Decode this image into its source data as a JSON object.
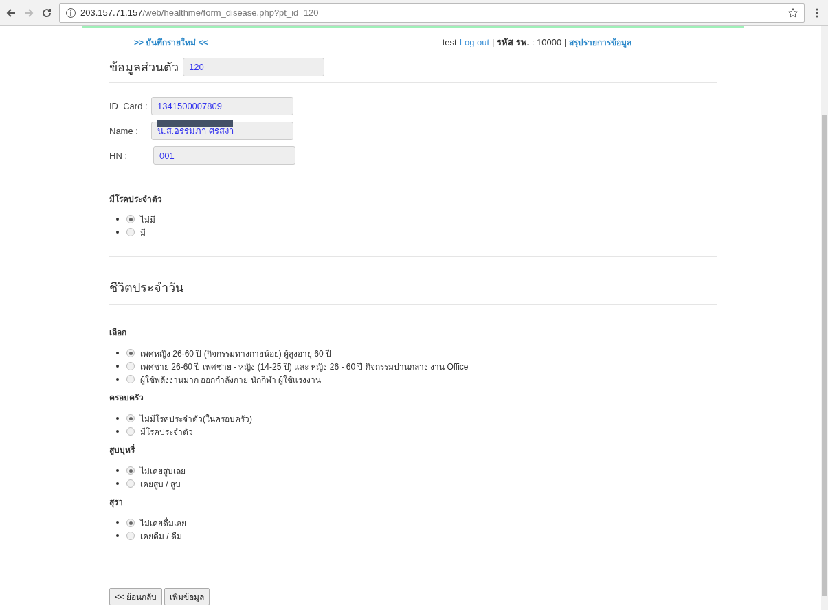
{
  "browser": {
    "url_host": "203.157.71.157",
    "url_path": "/web/healthme/form_disease.php?pt_id=120"
  },
  "header": {
    "new_record_link": ">> บันทึกรายใหม่ <<",
    "user": "test",
    "logout_link": "Log out",
    "hospital_code": "| **รหัส รพ.** : 10000 |",
    "summary_link": "สรุปรายการข้อมูล"
  },
  "personal": {
    "title": "ข้อมูลส่วนตัว",
    "pt_id": "120",
    "fields": [
      {
        "label": "ID_Card :",
        "value": "1341500007809",
        "redacted": false
      },
      {
        "label": "Name :",
        "value": "น.ส.อรรมภา ศรสงา",
        "redacted": true
      },
      {
        "label": "HN :",
        "value": "001",
        "redacted": false
      }
    ]
  },
  "disease": {
    "title": "มีโรคประจำตัว",
    "options": [
      {
        "label": "ไม่มี",
        "selected": true
      },
      {
        "label": "มี",
        "selected": false
      }
    ]
  },
  "daily": {
    "title": "ชีวิตประจำวัน",
    "groups": [
      {
        "title": "เลือก",
        "options": [
          {
            "label": "เพศหญิง 26-60 ปี (กิจกรรมทางกายน้อย) ผู้สูงอายุ 60 ปี",
            "selected": true
          },
          {
            "label": "เพศชาย 26-60 ปี เพศชาย - หญิง (14-25 ปี) และ หญิง 26 - 60 ปี กิจกรรมปานกลาง งาน Office",
            "selected": false
          },
          {
            "label": "ผู้ใช้พลังงานมาก ออกกำลังกาย นักกีฬา ผู้ใช้แรงงาน",
            "selected": false
          }
        ]
      },
      {
        "title": "ครอบครัว",
        "options": [
          {
            "label": "ไม่มีโรคประจำตัว(ในครอบครัว)",
            "selected": true
          },
          {
            "label": "มีโรคประจำตัว",
            "selected": false
          }
        ]
      },
      {
        "title": "สูบบุหรี่",
        "options": [
          {
            "label": "ไม่เคยสูบเลย",
            "selected": true
          },
          {
            "label": "เคยสูบ / สูบ",
            "selected": false
          }
        ]
      },
      {
        "title": "สุรา",
        "options": [
          {
            "label": "ไม่เคยดื่มเลย",
            "selected": true
          },
          {
            "label": "เคยดื่ม / ดื่ม",
            "selected": false
          }
        ]
      }
    ]
  },
  "buttons": [
    "<< ย้อนกลับ",
    "เพิ่มข้อมูล"
  ]
}
